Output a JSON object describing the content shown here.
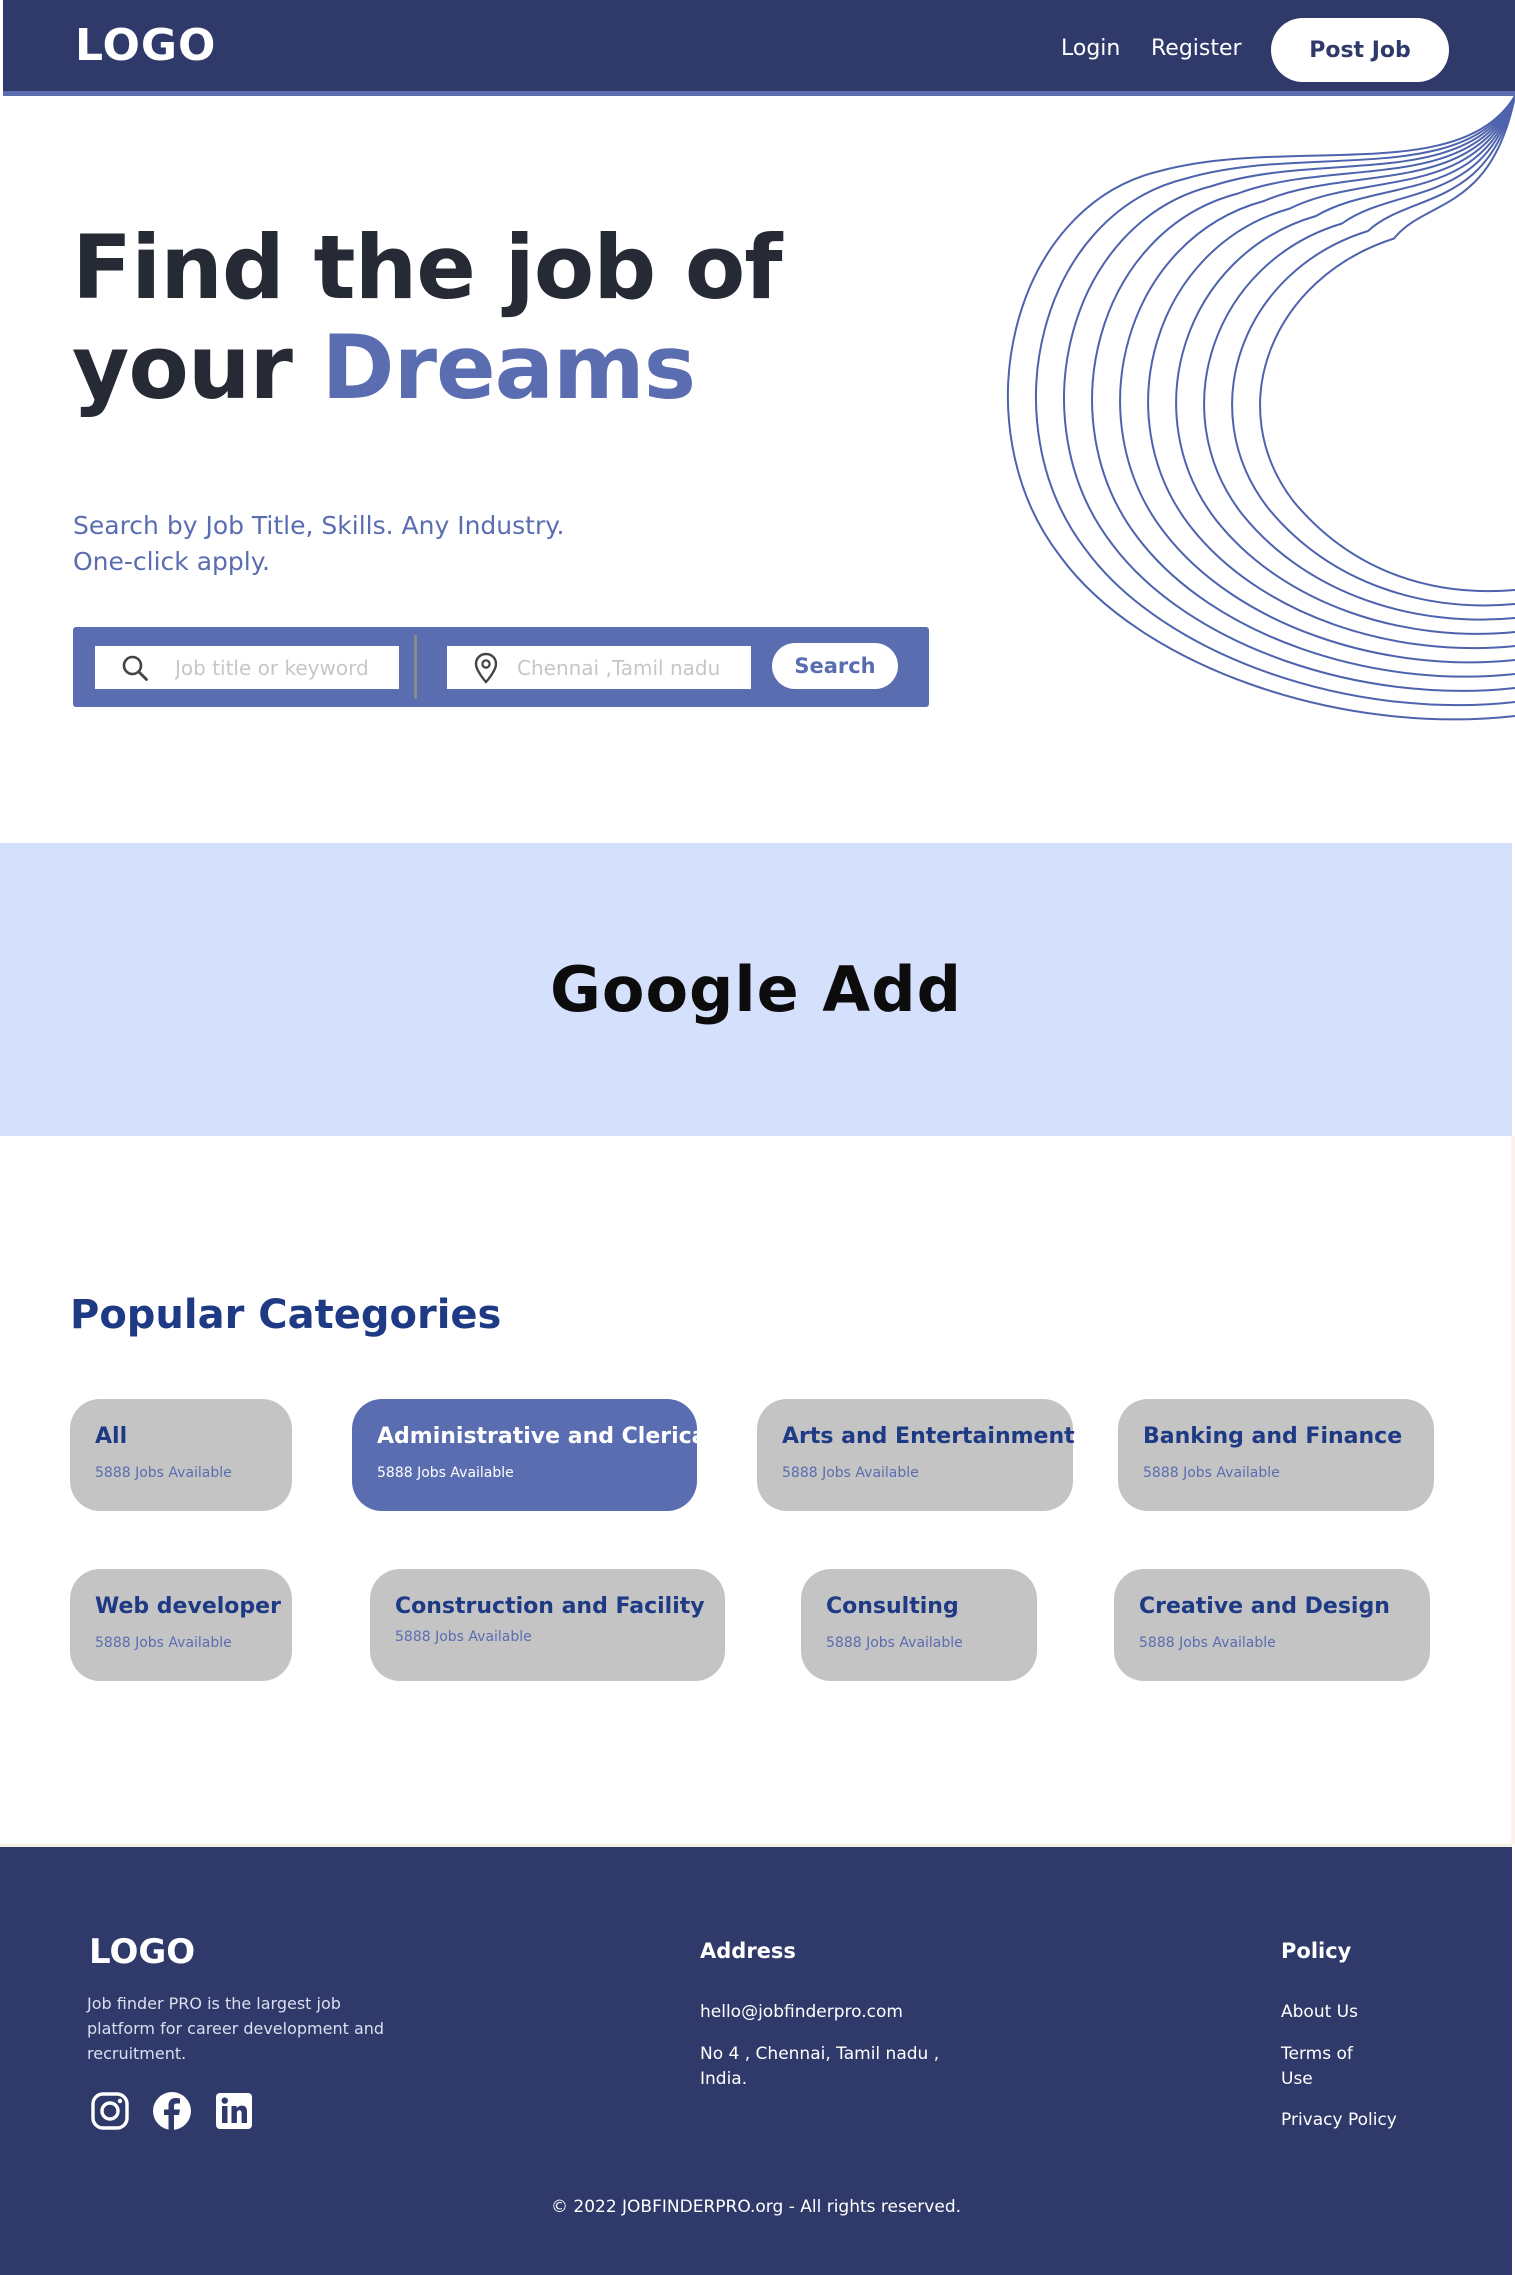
{
  "header": {
    "logo": "LOGO",
    "nav": {
      "login": "Login",
      "register": "Register"
    },
    "post_job": "Post Job"
  },
  "hero": {
    "title_line1": "Find the job of",
    "title_line2_prefix": "your ",
    "title_accent": "Dreams",
    "subtitle_line1": "Search by Job Title, Skills. Any Industry.",
    "subtitle_line2": "One-click apply."
  },
  "search": {
    "keyword_placeholder": "Job title or keyword",
    "location_placeholder": "Chennai ,Tamil nadu",
    "button": "Search",
    "icons": [
      "search-icon",
      "location-pin-icon"
    ]
  },
  "ad": {
    "text": "Google Add"
  },
  "categories": {
    "title": "Popular Categories",
    "items": [
      {
        "name": "All",
        "count": "5888 Jobs Available"
      },
      {
        "name": "Administrative and Clerical",
        "count": "5888 Jobs Available",
        "active": true
      },
      {
        "name": "Arts and Entertainment",
        "count": "5888 Jobs Available"
      },
      {
        "name": "Banking and Finance",
        "count": "5888 Jobs Available"
      },
      {
        "name": "Web developer",
        "count": "5888 Jobs Available"
      },
      {
        "name": "Construction and Facility",
        "count": "5888 Jobs Available"
      },
      {
        "name": "Consulting",
        "count": "5888 Jobs Available"
      },
      {
        "name": "Creative and Design",
        "count": "5888 Jobs Available"
      }
    ]
  },
  "footer": {
    "logo": "LOGO",
    "description": "Job finder PRO is the largest job platform for career development and recruitment.",
    "social": [
      "instagram-icon",
      "facebook-icon",
      "linkedin-icon"
    ],
    "address": {
      "heading": "Address",
      "email": "hello@jobfinderpro.com",
      "line1": "No 4 , Chennai, Tamil nadu ,",
      "line2": "India."
    },
    "policy": {
      "heading": "Policy",
      "about": "About Us",
      "terms_line1": "Terms of",
      "terms_line2": "Use",
      "privacy": "Privacy Policy"
    },
    "copyright": "© 2022 JOBFINDERPRO.org - All rights reserved."
  },
  "colors": {
    "primary_dark": "#2f3a6a",
    "accent": "#5a6db0",
    "ad_bg": "#d4e0fc",
    "category_bg": "#c4c4c4",
    "category_text": "#1f3a84"
  }
}
